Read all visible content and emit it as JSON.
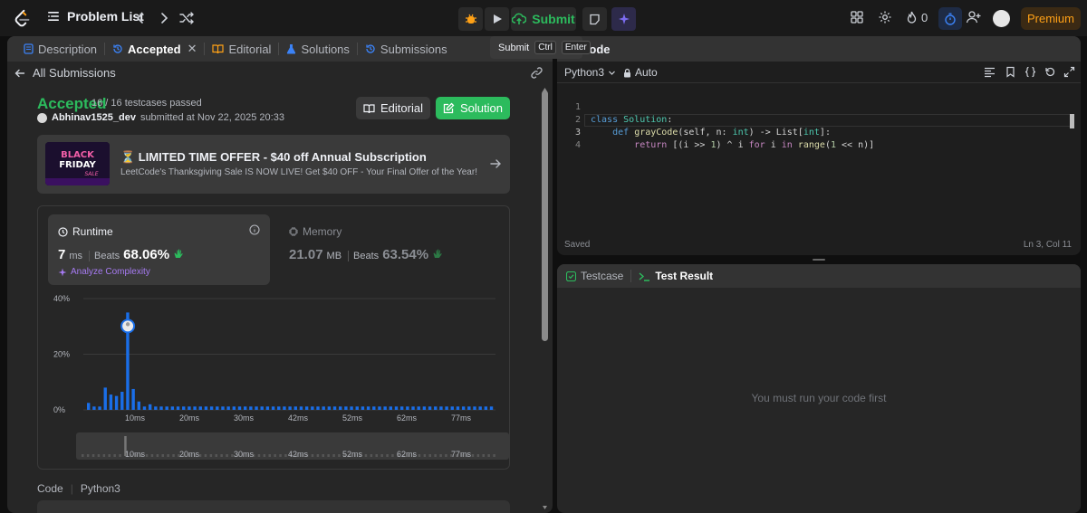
{
  "topnav": {
    "problem_list": "Problem List",
    "submit": "Submit",
    "streak_count": "0",
    "premium": "Premium"
  },
  "tooltip": {
    "label": "Submit",
    "key1": "Ctrl",
    "key2": "Enter"
  },
  "left_tabs": [
    {
      "label": "Description",
      "icon": "description-icon",
      "color": "#3b82f6"
    },
    {
      "label": "Accepted",
      "icon": "history-icon",
      "color": "#3b82f6",
      "active": true
    },
    {
      "label": "Editorial",
      "icon": "book-icon",
      "color": "#ffa116"
    },
    {
      "label": "Solutions",
      "icon": "flask-icon",
      "color": "#3b82f6"
    },
    {
      "label": "Submissions",
      "icon": "history-icon",
      "color": "#3b82f6"
    }
  ],
  "submission": {
    "back_label": "All Submissions",
    "status": "Accepted",
    "testcases": "16 / 16 testcases passed",
    "author": "Abhinav1525_dev",
    "submitted_at": "submitted at Nov 22, 2025 20:33",
    "editorial_btn": "Editorial",
    "solution_btn": "Solution"
  },
  "promo": {
    "title": "⏳ LIMITED TIME OFFER - $40 off Annual Subscription",
    "subtitle": "LeetCode's Thanksgiving Sale IS NOW LIVE! Get $40 OFF - Your Final Offer of the Year!",
    "image_line1": "BLACK",
    "image_line2": "FRIDAY",
    "image_line3": "SALE"
  },
  "runtime": {
    "label": "Runtime",
    "value": "7",
    "unit": "ms",
    "beats_label": "Beats",
    "beats_pct": "68.06%",
    "analyze": "Analyze Complexity"
  },
  "memory": {
    "label": "Memory",
    "value": "21.07",
    "unit": "MB",
    "beats_label": "Beats",
    "beats_pct": "63.54%"
  },
  "chart_data": {
    "type": "bar",
    "y_ticks": [
      "40%",
      "20%",
      "0%"
    ],
    "ylim": [
      0,
      40
    ],
    "x_ticks": [
      "10ms",
      "20ms",
      "30ms",
      "42ms",
      "52ms",
      "62ms",
      "77ms"
    ],
    "values": [
      2.5,
      1.2,
      1.2,
      8,
      5.5,
      5,
      6.5,
      35,
      7.5,
      3,
      1.2,
      2,
      1.2,
      1.2,
      1.2,
      1.2,
      1.2,
      1.2,
      1.2,
      1.2,
      1.2,
      1.2,
      1.2,
      1.2,
      1.2,
      1.2,
      1.2,
      1.2,
      1.2,
      1.2,
      1.2,
      1.2,
      1.2,
      1.2,
      1.2,
      1.2,
      1.2,
      1.2,
      1.2,
      1.2,
      1.2,
      1.2,
      1.2,
      1.2,
      1.2,
      1.2,
      1.2,
      1.2,
      1.2,
      1.2,
      1.2,
      1.2,
      1.2,
      1.2,
      1.2,
      1.2,
      1.2,
      1.2,
      1.2,
      1.2,
      1.2,
      1.2,
      1.2,
      1.2,
      1.2,
      1.2,
      1.2,
      1.2,
      1.2,
      1.2,
      1.2,
      1.2,
      1.2
    ],
    "highlight_index": 7,
    "bar_color": "#1a6ee8"
  },
  "code_section": {
    "label": "Code",
    "lang": "Python3"
  },
  "editor": {
    "title": "Code",
    "language": "Python3",
    "mode": "Auto",
    "lines": [
      "class Solution:",
      "    def grayCode(self, n: int) -> List[int]:",
      "        return [(i >> 1) ^ i for i in range(1 << n)]",
      ""
    ],
    "saved": "Saved",
    "cursor": "Ln 3, Col 11"
  },
  "test_panel": {
    "testcase_tab": "Testcase",
    "result_tab": "Test Result",
    "empty_message": "You must run your code first"
  }
}
